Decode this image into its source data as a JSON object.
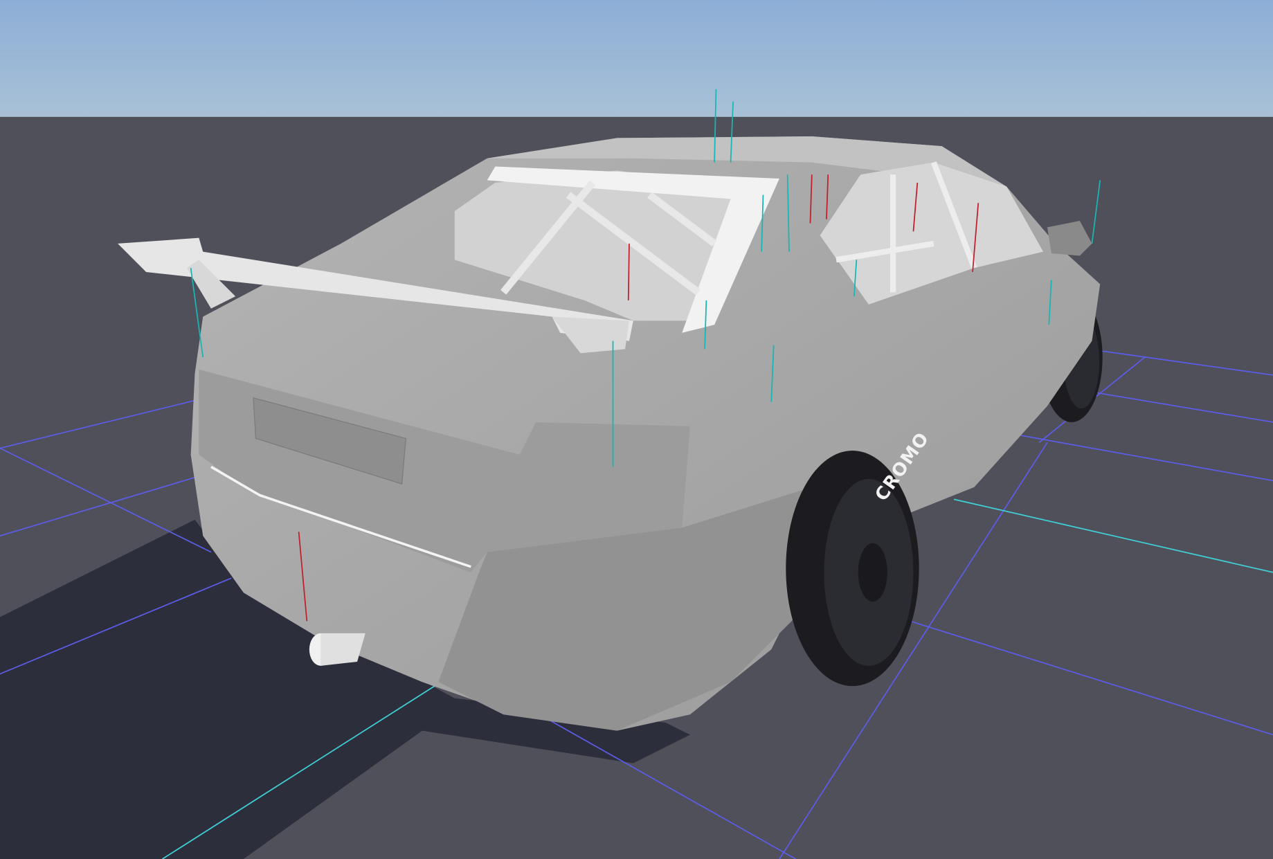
{
  "scene": {
    "view": "3d-viewport",
    "subject": "race-car-model",
    "sky_colors": [
      "#8daed6",
      "#a8c1d6"
    ],
    "ground_color": "#4f5059",
    "shadow_color": "#2d2e3b",
    "grid_color": "#5c5ce6",
    "axis_color": "#3fd0d6",
    "body_color": "#a9a9a9",
    "gizmo_colors": [
      "#19b5b5",
      "#c0202a"
    ]
  },
  "car": {
    "tire_logo": "CROMO"
  }
}
